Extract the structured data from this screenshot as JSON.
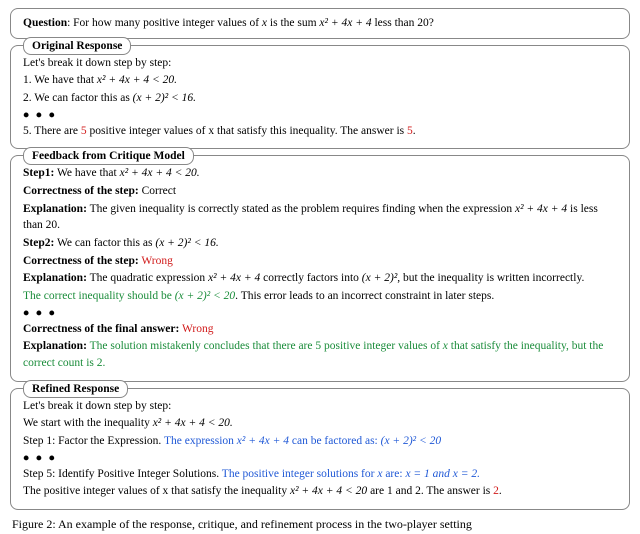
{
  "question": {
    "label": "Question",
    "text_before": ": For how many positive integer values of ",
    "var": "x",
    "text_mid": " is the sum ",
    "expr": "x² + 4x + 4",
    "text_after": " less than 20?"
  },
  "original": {
    "title": "Original Response",
    "intro": "Let's break it down step by step:",
    "s1_a": "1. We have that ",
    "s1_b": "x² + 4x + 4 < 20.",
    "s2_a": "2. We can factor this as ",
    "s2_b": "(x + 2)² < 16.",
    "ellipsis": "• • •",
    "s5_a": "5. There are ",
    "s5_b": "5",
    "s5_c": " positive integer values of x that satisfy this inequality. The answer is ",
    "s5_d": "5",
    "s5_e": "."
  },
  "feedback": {
    "title": "Feedback from Critique Model",
    "step1_lbl": "Step1:",
    "step1_txt_a": " We have that ",
    "step1_txt_b": "x² + 4x + 4 < 20.",
    "corr1_lbl": "Correctness of the step:",
    "corr1_val": " Correct",
    "exp1_lbl": "Explanation:",
    "exp1_txt_a": " The given inequality is correctly stated as the problem requires finding when the expression ",
    "exp1_expr": "x² + 4x + 4",
    "exp1_txt_b": " is less than 20.",
    "step2_lbl": "Step2:",
    "step2_txt_a": " We can factor this as ",
    "step2_txt_b": "(x + 2)² < 16.",
    "corr2_lbl": "Correctness of the step:",
    "corr2_val": " Wrong",
    "exp2_lbl": "Explanation:",
    "exp2_txt_a": " The quadratic expression ",
    "exp2_expr1": "x² + 4x + 4",
    "exp2_txt_b": " correctly factors into ",
    "exp2_expr2": "(x + 2)²",
    "exp2_txt_c": ", but the inequality is written incorrectly.",
    "exp2_green_a": "The correct inequality should be ",
    "exp2_green_expr": "(x + 2)² < 20",
    "exp2_txt_d": ". This error leads to an incorrect constraint in later steps.",
    "ellipsis": "• • •",
    "corrF_lbl": "Correctness of the final answer:",
    "corrF_val": " Wrong",
    "expF_lbl": "Explanation:",
    "expF_green_a": " The solution mistakenly concludes that there are 5 positive integer values of ",
    "expF_green_var": "x",
    "expF_green_b": " that satisfy the inequality, but the correct count is 2."
  },
  "refined": {
    "title": "Refined Response",
    "intro": "Let's break it down step by step:",
    "start_a": "We start with the inequality ",
    "start_b": "x² + 4x + 4 < 20.",
    "s1_a": "Step 1: Factor the Expression. ",
    "s1_blue_a": "The expression ",
    "s1_blue_expr1": "x² + 4x + 4",
    "s1_blue_b": " can be factored as: ",
    "s1_blue_expr2": "(x + 2)² < 20",
    "ellipsis": "• • •",
    "s5_a": "Step 5: Identify Positive Integer Solutions. ",
    "s5_blue_a": "The positive integer solutions for ",
    "s5_blue_var": "x",
    "s5_blue_b": " are: ",
    "s5_blue_c": "x = 1 and x = 2.",
    "final_a": "The positive integer values of x that satisfy the inequality ",
    "final_expr": "x² + 4x + 4 < 20",
    "final_b": " are 1 and 2. The answer is ",
    "final_ans": "2",
    "final_c": "."
  },
  "caption": "Figure 2:   An example of the response, critique, and refinement process in the two-player setting"
}
